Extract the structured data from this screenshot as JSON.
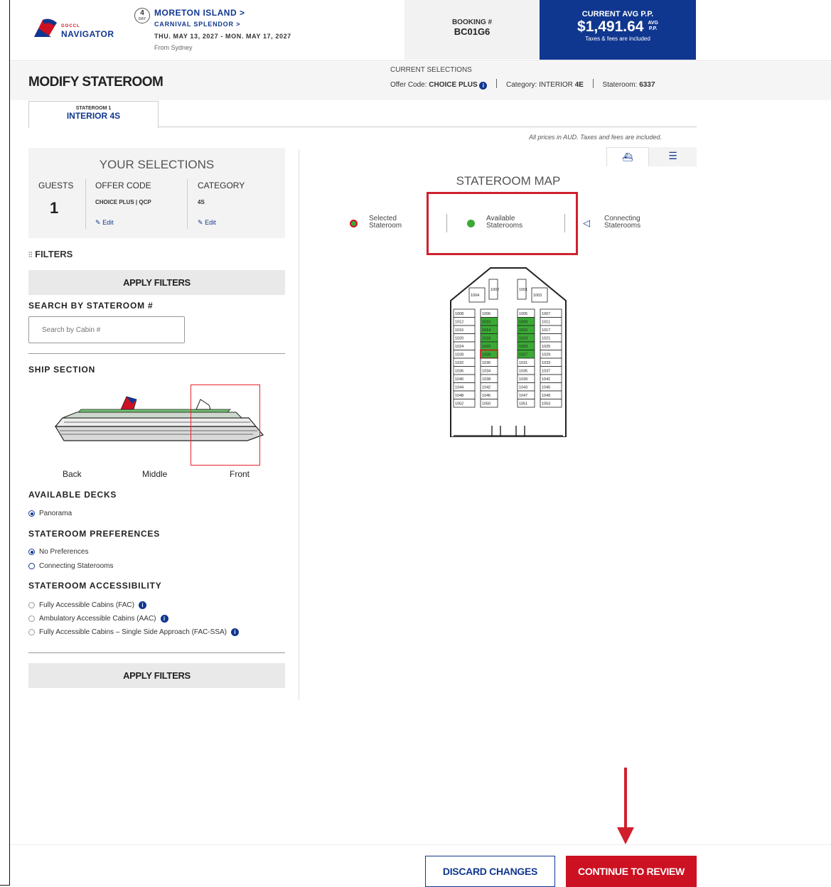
{
  "header": {
    "logo_top": "GOCCL",
    "logo_text": "NAVIGATOR",
    "day_count": "4",
    "day_label": "DAY",
    "trip_title": "MORETON ISLAND >",
    "ship_name": "CARNIVAL SPLENDOR >",
    "dates": "THU. MAY 13, 2027 - MON. MAY 17, 2027",
    "from": "From Sydney",
    "booking_label": "BOOKING #",
    "booking_number": "BC01G6",
    "price_label": "CURRENT AVG P.P.",
    "price_value": "$1,491.64",
    "price_suffix_top": "AVG",
    "price_suffix_bottom": "P.P.",
    "price_note": "Taxes & fees are included"
  },
  "modify": {
    "title": "MODIFY STATEROOM",
    "current_label": "CURRENT SELECTIONS",
    "offer_code_label": "Offer Code:",
    "offer_code_value": "CHOICE PLUS",
    "category_label": "Category:",
    "category_text": "INTERIOR",
    "category_value": "4E",
    "stateroom_label": "Stateroom:",
    "stateroom_value": "6337"
  },
  "tab": {
    "small": "STATEROOM 1",
    "big": "INTERIOR 4S"
  },
  "prices_note": "All prices in AUD. Taxes and fees are included.",
  "selections": {
    "title": "YOUR SELECTIONS",
    "guests_label": "GUESTS",
    "guests_value": "1",
    "offer_label": "OFFER CODE",
    "offer_value": "CHOICE PLUS | QCP",
    "category_label": "CATEGORY",
    "category_value": "4S",
    "edit_label": "Edit"
  },
  "filters": {
    "label": "FILTERS",
    "apply_label": "APPLY FILTERS",
    "search_heading": "SEARCH BY STATEROOM #",
    "search_placeholder": "Search by Cabin #",
    "ship_section_heading": "SHIP SECTION",
    "sections": [
      "Back",
      "Middle",
      "Front"
    ],
    "decks_heading": "AVAILABLE DECKS",
    "decks": [
      "Panorama"
    ],
    "prefs_heading": "STATEROOM PREFERENCES",
    "prefs": [
      "No Preferences",
      "Connecting Staterooms"
    ],
    "access_heading": "STATEROOM ACCESSIBILITY",
    "access": [
      "Fully Accessible Cabins (FAC)",
      "Ambulatory Accessible Cabins (AAC)",
      "Fully Accessible Cabins – Single Side Approach (FAC-SSA)"
    ]
  },
  "map": {
    "title": "STATEROOM MAP",
    "legend": {
      "selected_1": "Selected",
      "selected_2": "Stateroom",
      "available_1": "Available",
      "available_2": "Staterooms",
      "connecting_1": "Connecting",
      "connecting_2": "Staterooms"
    },
    "top_cabins": [
      "1004",
      "1002",
      "1001",
      "1003"
    ],
    "left_outer": [
      "1008",
      "1012",
      "1016",
      "1020",
      "1024",
      "1028",
      "1032",
      "1036",
      "1040",
      "1044",
      "1048",
      "1052"
    ],
    "left_inner": [
      "1006",
      "1010",
      "1014",
      "1018",
      "1022",
      "1026",
      "1030",
      "1034",
      "1038",
      "1042",
      "1046",
      "1050"
    ],
    "right_inner": [
      "1005",
      "1009",
      "1015",
      "1019",
      "1023",
      "1027",
      "1031",
      "1035",
      "1039",
      "1043",
      "1047",
      "1051"
    ],
    "right_outer": [
      "1007",
      "1011",
      "1017",
      "1021",
      "1025",
      "1029",
      "1033",
      "1037",
      "1041",
      "1045",
      "1049",
      "1053"
    ],
    "available": [
      "1010",
      "1014",
      "1018",
      "1022",
      "1009",
      "1015",
      "1019",
      "1023",
      "1027"
    ],
    "selected": [
      "1026"
    ]
  },
  "colors": {
    "brand_blue": "#10378f",
    "brand_red": "#cc1122",
    "available_green": "#3aaa35",
    "highlight_red": "#d0202e"
  },
  "footer": {
    "discard_label": "DISCARD CHANGES",
    "continue_label": "CONTINUE TO REVIEW"
  }
}
